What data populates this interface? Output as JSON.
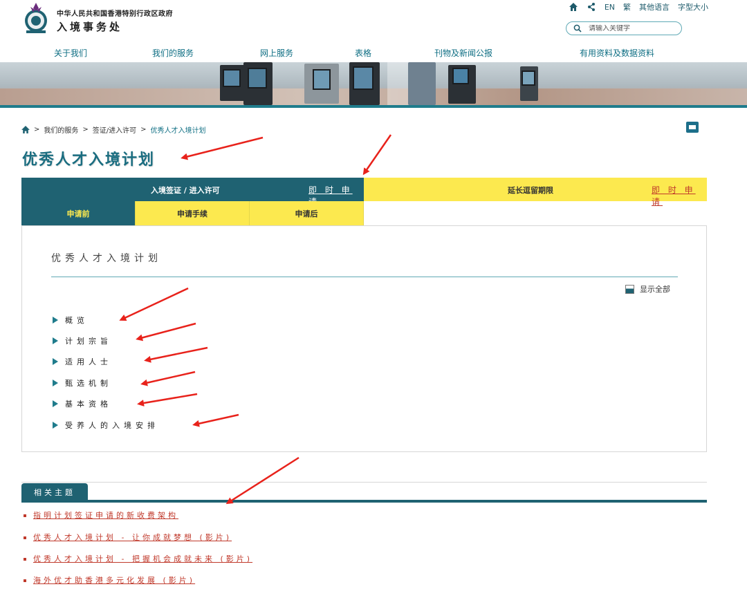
{
  "header": {
    "gov_name": "中华人民共和国香港特别行政区政府",
    "dept_name": "入境事务处",
    "utility": {
      "home_icon": "home-icon",
      "share_icon": "share-icon",
      "lang_en": "EN",
      "lang_trad": "繁",
      "other_lang": "其他语言",
      "font_size": "字型大小"
    },
    "search": {
      "placeholder": "请输入关键字",
      "icon": "search-icon"
    }
  },
  "nav": {
    "items": [
      "关于我们",
      "我们的服务",
      "网上服务",
      "表格",
      "刊物及新闻公报",
      "有用资料及数据资料"
    ]
  },
  "breadcrumb": {
    "home_icon": "home-icon",
    "separator": ">",
    "items": [
      "我们的服务",
      "签证/进入许可"
    ],
    "current": "优秀人才入境计划"
  },
  "page_title": "优秀人才入境计划",
  "tabs": {
    "main": [
      {
        "label": "入境签证 / 进入许可",
        "apply": "即 时 申 请",
        "active": true
      },
      {
        "label": "延长逗留期限",
        "apply": "即 时 申 请",
        "active": false
      }
    ],
    "sub": [
      {
        "label": "申请前",
        "active": true
      },
      {
        "label": "申请手续",
        "active": false
      },
      {
        "label": "申请后",
        "active": false
      }
    ]
  },
  "content": {
    "section_title": "优秀人才入境计划",
    "show_all": "显示全部",
    "items": [
      "概览",
      "计划宗旨",
      "适用人士",
      "甄选机制",
      "基本资格",
      "受养人的入境安排"
    ]
  },
  "related": {
    "title": "相关主题",
    "links": [
      "指明计划签证申请的新收费架构",
      "优秀人才入境计划 - 让你成就梦想 (影片)",
      "优秀人才入境计划 - 把握机会成就未来 (影片)",
      "海外优才助香港多元化发展 (影片)"
    ]
  },
  "colors": {
    "primary_teal": "#1f6272",
    "accent_yellow": "#fce94f",
    "link_red": "#c0392b",
    "nav_text": "#0e6e83",
    "annotation_arrow": "#e8221b"
  }
}
